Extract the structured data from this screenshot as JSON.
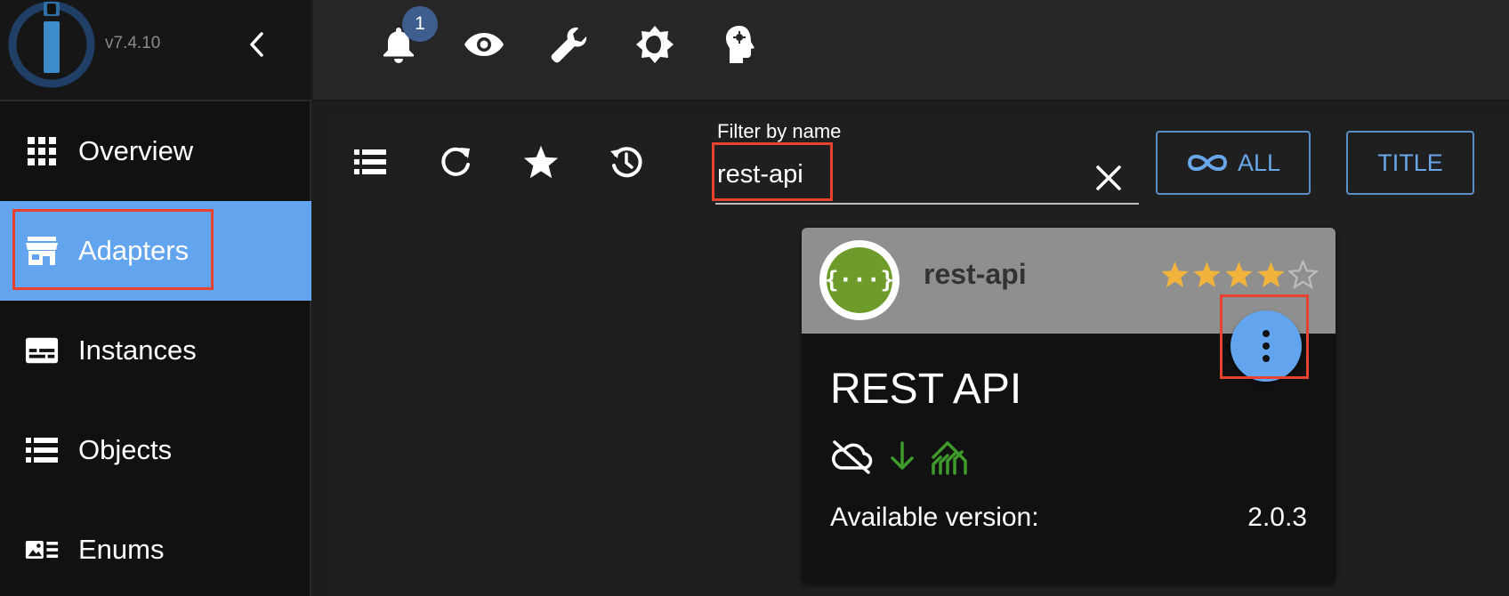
{
  "app": {
    "version": "v7.4.10"
  },
  "topbar": {
    "notification_count": "1"
  },
  "sidebar": {
    "items": [
      {
        "label": "Overview",
        "icon": "grid-icon"
      },
      {
        "label": "Adapters",
        "icon": "store-icon",
        "active": true
      },
      {
        "label": "Instances",
        "icon": "instances-icon"
      },
      {
        "label": "Objects",
        "icon": "list-icon"
      },
      {
        "label": "Enums",
        "icon": "enums-icon"
      }
    ]
  },
  "filter": {
    "label": "Filter by name",
    "value": "rest-api"
  },
  "buttons": {
    "all_label": "ALL",
    "title_label": "TITLE"
  },
  "card": {
    "name": "rest-api",
    "title": "REST API",
    "logo_text": "{···}",
    "rating_filled": 4,
    "rating_total": 5,
    "available_label": "Available version:",
    "available_version": "2.0.3"
  },
  "colors": {
    "accent": "#63a4ee",
    "highlight": "#e8422f",
    "star": "#f2b33d",
    "green": "#3f9a2c"
  }
}
